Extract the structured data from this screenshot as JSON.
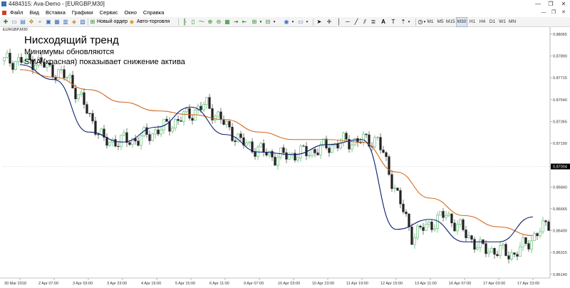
{
  "window": {
    "title": "4484315: Ava-Demo - [EURGBP,M30]",
    "controls": [
      "—",
      "❐",
      "✕"
    ]
  },
  "menu": {
    "items": [
      "Файл",
      "Вид",
      "Вставка",
      "Графики",
      "Сервис",
      "Окно",
      "Справка"
    ],
    "mdi_controls": [
      "—",
      "❐",
      "✕"
    ]
  },
  "toolbar": {
    "new_order": "Новый ордер",
    "auto_trading": "Авто-торговля",
    "timeframes": [
      "M1",
      "M5",
      "M15",
      "M30",
      "H1",
      "H4",
      "D1",
      "W1",
      "MN"
    ],
    "active_timeframe": "M30"
  },
  "chart": {
    "tab_label": "EURGBP,M30",
    "annotation_title": "Нисходящий тренд",
    "annotation_line1": "Минимумы обновляются",
    "annotation_line2": "SMA (красная) показывает снижение актива",
    "current_price": "0.87004",
    "colors": {
      "sma": "#d2691e",
      "fast_ma": "#0b1e6e",
      "candle_up": "#2fa84f",
      "candle_down": "#222222",
      "bg": "#ffffff",
      "grid": "#eeeeee",
      "price_tag": "#000000"
    }
  },
  "chart_data": {
    "type": "line",
    "title": "Нисходящий тренд",
    "x": [
      "30 Mar 2018",
      "2 Apr 07:00",
      "3 Apr 03:00",
      "3 Apr 23:00",
      "4 Apr 19:00",
      "5 Apr 15:00",
      "6 Apr 11:00",
      "9 Apr 07:00",
      "10 Apr 03:00",
      "10 Apr 23:00",
      "11 Apr 19:00",
      "12 Apr 15:00",
      "13 Apr 11:00",
      "16 Apr 07:00",
      "17 Apr 03:00",
      "17 Apr 23:00"
    ],
    "y_ticks": [
      "0.88065",
      "0.87890",
      "0.87715",
      "0.87540",
      "0.87365",
      "0.87190",
      "0.87004",
      "0.86840",
      "0.86665",
      "0.86490",
      "0.86315",
      "0.86140"
    ],
    "ylim": [
      0.8611,
      0.8811
    ],
    "series": [
      {
        "name": "SMA (красная)",
        "values": [
          0.8778,
          0.8772,
          0.8762,
          0.8752,
          0.8745,
          0.8742,
          0.8738,
          0.8728,
          0.8722,
          0.8722,
          0.872,
          0.8696,
          0.8675,
          0.8661,
          0.8652,
          0.8645
        ]
      },
      {
        "name": "",
        "values": [
          0.8782,
          0.877,
          0.8728,
          0.872,
          0.8732,
          0.8748,
          0.8726,
          0.8712,
          0.871,
          0.8718,
          0.8722,
          0.865,
          0.8658,
          0.864,
          0.864,
          0.866
        ]
      }
    ],
    "candles_close": [
      0.8785,
      0.877,
      0.872,
      0.8722,
      0.8735,
      0.875,
      0.872,
      0.8708,
      0.8712,
      0.872,
      0.8722,
      0.8645,
      0.8662,
      0.8635,
      0.863,
      0.8655
    ]
  }
}
